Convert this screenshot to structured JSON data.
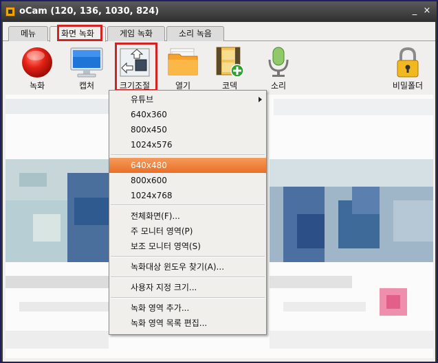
{
  "window": {
    "title": "oCam (120, 136, 1030, 824)",
    "minimize_glyph": "_",
    "close_glyph": "×"
  },
  "tabs": [
    {
      "label": "메뉴"
    },
    {
      "label": "화면 녹화"
    },
    {
      "label": "게임 녹화"
    },
    {
      "label": "소리 녹음"
    }
  ],
  "toolbar": {
    "record": "녹화",
    "capture": "캡처",
    "resize": "크기조절",
    "open": "열기",
    "codec": "코덱",
    "sound": "소리",
    "secret_folder": "비밀폴더"
  },
  "menu": {
    "youtube": "유튜브",
    "r640x360": "640x360",
    "r800x450": "800x450",
    "r1024x576": "1024x576",
    "r640x480": "640x480",
    "r800x600": "800x600",
    "r1024x768": "1024x768",
    "fullscreen": "전체화면(F)...",
    "main_monitor": "주 모니터 영역(P)",
    "sub_monitor": "보조 모니터 영역(S)",
    "find_window": "녹화대상 윈도우 찾기(A)...",
    "custom_size": "사용자 지정 크기...",
    "add_area": "녹화 영역 추가...",
    "edit_area_list": "녹화 영역 목록 편집..."
  },
  "colors": {
    "selection": "#e96f27",
    "highlight_box": "#d32222",
    "title_bg": "#3a3a3a"
  }
}
